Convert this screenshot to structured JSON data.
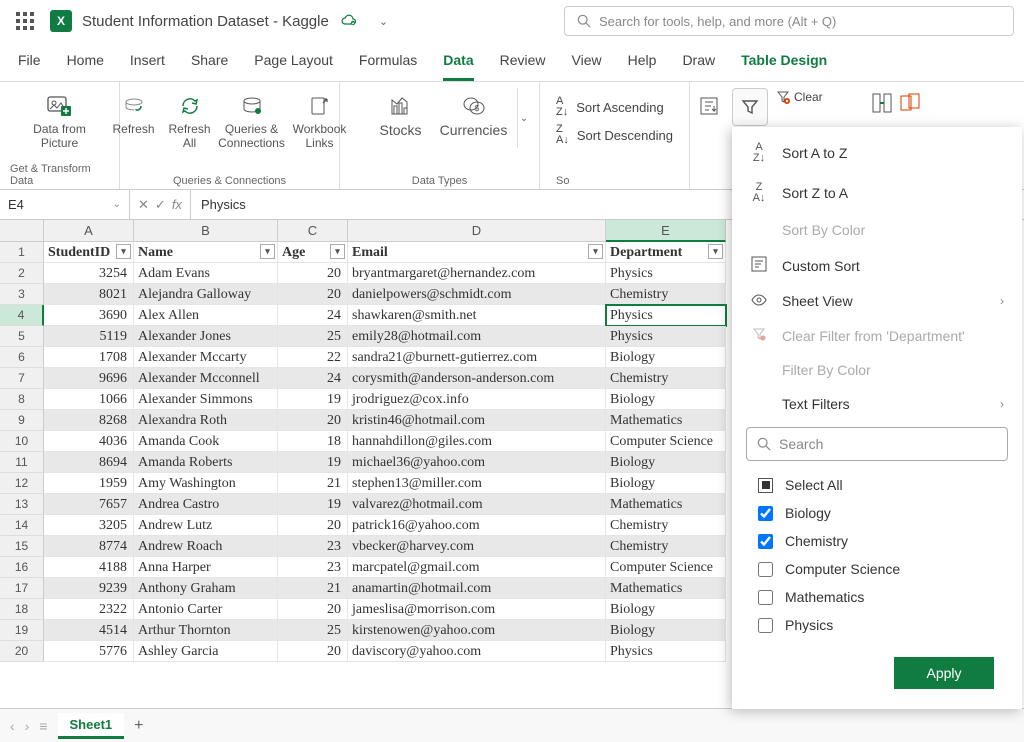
{
  "app": {
    "title": "Student Information Dataset - Kaggle",
    "search_placeholder": "Search for tools, help, and more (Alt + Q)"
  },
  "menu": {
    "file": "File",
    "home": "Home",
    "insert": "Insert",
    "share": "Share",
    "page_layout": "Page Layout",
    "formulas": "Formulas",
    "data": "Data",
    "review": "Review",
    "view": "View",
    "help": "Help",
    "draw": "Draw",
    "table_design": "Table Design"
  },
  "ribbon": {
    "data_from_picture": "Data from\nPicture",
    "get_transform_label": "Get & Transform Data",
    "refresh": "Refresh",
    "refresh_all": "Refresh\nAll",
    "queries_connections": "Queries &\nConnections",
    "workbook_links": "Workbook\nLinks",
    "qc_label": "Queries & Connections",
    "stocks": "Stocks",
    "currencies": "Currencies",
    "datatypes_label": "Data Types",
    "sort_asc": "Sort Ascending",
    "sort_desc": "Sort Descending",
    "sort_label": "So",
    "clear": "Clear"
  },
  "formula_bar": {
    "cell_ref": "E4",
    "value": "Physics"
  },
  "columns": [
    "A",
    "B",
    "C",
    "D",
    "E"
  ],
  "headers": {
    "student_id": "StudentID",
    "name": "Name",
    "age": "Age",
    "email": "Email",
    "department": "Department"
  },
  "rows": [
    {
      "id": "3254",
      "name": "Adam Evans",
      "age": "20",
      "email": "bryantmargaret@hernandez.com",
      "dept": "Physics"
    },
    {
      "id": "8021",
      "name": "Alejandra Galloway",
      "age": "20",
      "email": "danielpowers@schmidt.com",
      "dept": "Chemistry"
    },
    {
      "id": "3690",
      "name": "Alex Allen",
      "age": "24",
      "email": "shawkaren@smith.net",
      "dept": "Physics"
    },
    {
      "id": "5119",
      "name": "Alexander Jones",
      "age": "25",
      "email": "emily28@hotmail.com",
      "dept": "Physics"
    },
    {
      "id": "1708",
      "name": "Alexander Mccarty",
      "age": "22",
      "email": "sandra21@burnett-gutierrez.com",
      "dept": "Biology"
    },
    {
      "id": "9696",
      "name": "Alexander Mcconnell",
      "age": "24",
      "email": "corysmith@anderson-anderson.com",
      "dept": "Chemistry"
    },
    {
      "id": "1066",
      "name": "Alexander Simmons",
      "age": "19",
      "email": "jrodriguez@cox.info",
      "dept": "Biology"
    },
    {
      "id": "8268",
      "name": "Alexandra Roth",
      "age": "20",
      "email": "kristin46@hotmail.com",
      "dept": "Mathematics"
    },
    {
      "id": "4036",
      "name": "Amanda Cook",
      "age": "18",
      "email": "hannahdillon@giles.com",
      "dept": "Computer Science"
    },
    {
      "id": "8694",
      "name": "Amanda Roberts",
      "age": "19",
      "email": "michael36@yahoo.com",
      "dept": "Biology"
    },
    {
      "id": "1959",
      "name": "Amy Washington",
      "age": "21",
      "email": "stephen13@miller.com",
      "dept": "Biology"
    },
    {
      "id": "7657",
      "name": "Andrea Castro",
      "age": "19",
      "email": "valvarez@hotmail.com",
      "dept": "Mathematics"
    },
    {
      "id": "3205",
      "name": "Andrew Lutz",
      "age": "20",
      "email": "patrick16@yahoo.com",
      "dept": "Chemistry"
    },
    {
      "id": "8774",
      "name": "Andrew Roach",
      "age": "23",
      "email": "vbecker@harvey.com",
      "dept": "Chemistry"
    },
    {
      "id": "4188",
      "name": "Anna Harper",
      "age": "23",
      "email": "marcpatel@gmail.com",
      "dept": "Computer Science"
    },
    {
      "id": "9239",
      "name": "Anthony Graham",
      "age": "21",
      "email": "anamartin@hotmail.com",
      "dept": "Mathematics"
    },
    {
      "id": "2322",
      "name": "Antonio Carter",
      "age": "20",
      "email": "jameslisa@morrison.com",
      "dept": "Biology"
    },
    {
      "id": "4514",
      "name": "Arthur Thornton",
      "age": "25",
      "email": "kirstenowen@yahoo.com",
      "dept": "Biology"
    },
    {
      "id": "5776",
      "name": "Ashley Garcia",
      "age": "20",
      "email": "daviscory@yahoo.com",
      "dept": "Physics"
    }
  ],
  "sheet": {
    "name": "Sheet1"
  },
  "filter_panel": {
    "sort_az": "Sort A to Z",
    "sort_za": "Sort Z to A",
    "sort_by_color": "Sort By Color",
    "custom_sort": "Custom Sort",
    "sheet_view": "Sheet View",
    "clear_filter": "Clear Filter from 'Department'",
    "filter_by_color": "Filter By Color",
    "text_filters": "Text Filters",
    "search_placeholder": "Search",
    "select_all": "Select All",
    "options": [
      {
        "label": "Biology",
        "checked": true
      },
      {
        "label": "Chemistry",
        "checked": true
      },
      {
        "label": "Computer Science",
        "checked": false
      },
      {
        "label": "Mathematics",
        "checked": false
      },
      {
        "label": "Physics",
        "checked": false
      }
    ],
    "apply": "Apply"
  }
}
